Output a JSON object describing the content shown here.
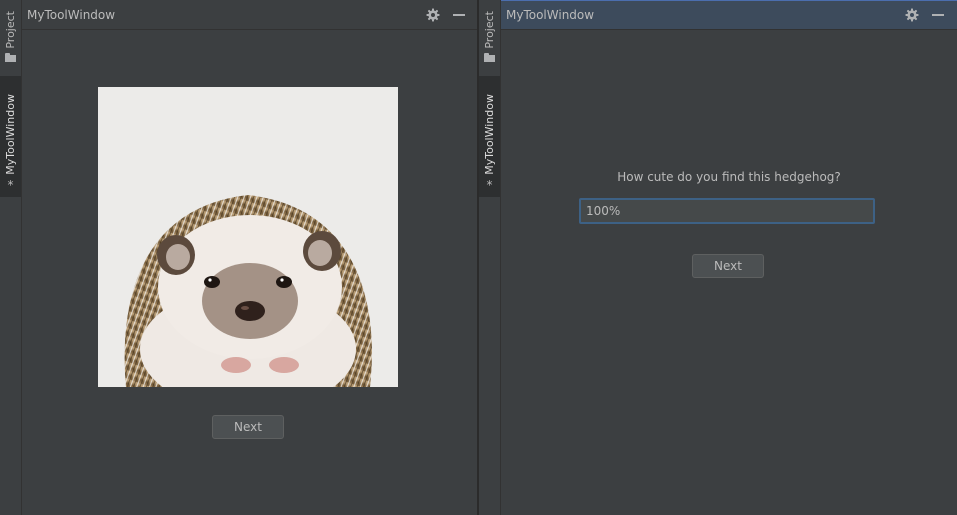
{
  "left_pane": {
    "stripe": {
      "project_label": "Project",
      "mytool_label": "MyToolWindow"
    },
    "tool_window": {
      "title": "MyToolWindow",
      "next_label": "Next"
    }
  },
  "right_pane": {
    "stripe": {
      "project_label": "Project",
      "mytool_label": "MyToolWindow"
    },
    "tool_window": {
      "title": "MyToolWindow",
      "question": "How cute do you find this hedgehog?",
      "answer_value": "100%",
      "next_label": "Next"
    }
  },
  "icons": {
    "settings": "gear-icon",
    "minimize": "minimize-icon",
    "project": "folder-icon",
    "tool_window": "star-icon"
  },
  "colors": {
    "background": "#3c3f41",
    "active_header": "#3d4b5c",
    "input_focus_border": "#3d6185"
  }
}
